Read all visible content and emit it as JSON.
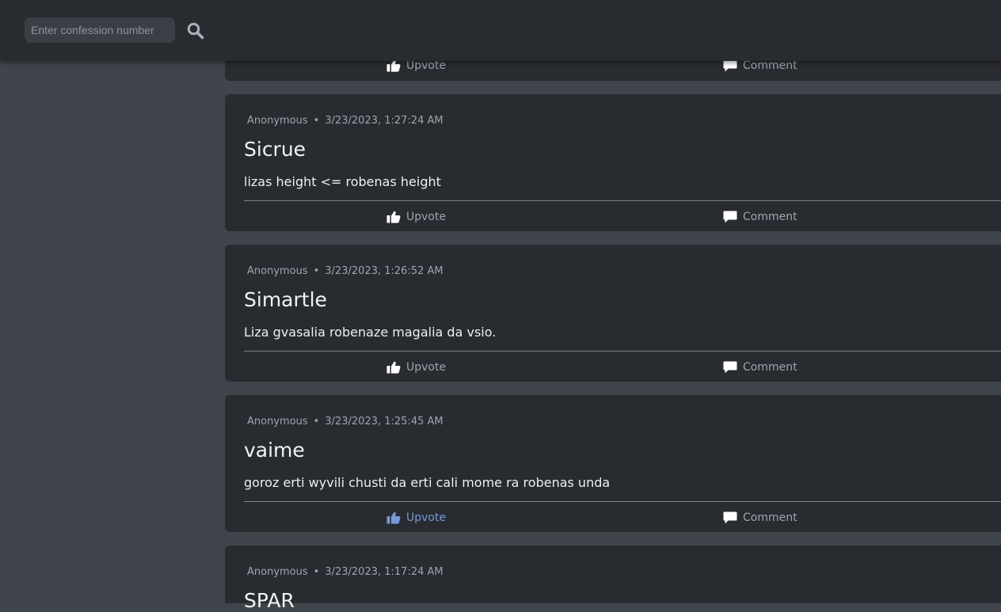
{
  "search": {
    "placeholder": "Enter confession number",
    "icon": "search-icon"
  },
  "labels": {
    "upvote": "Upvote",
    "comment": "Comment"
  },
  "colors": {
    "page_bg": "#40444b",
    "card_bg": "#282b30",
    "meta_text": "#9aa6b0",
    "upvote_active": "#7699d9"
  },
  "top_card": {
    "upvote_label": "Upvote",
    "comment_label": "Comment"
  },
  "posts": [
    {
      "author": "Anonymous",
      "timestamp": "3/23/2023, 1:27:24 AM",
      "title": "Sicrue",
      "body": "lizas height <= robenas height",
      "upvote_label": "Upvote",
      "comment_label": "Comment",
      "upvoted": false
    },
    {
      "author": "Anonymous",
      "timestamp": "3/23/2023, 1:26:52 AM",
      "title": "Simartle",
      "body": "Liza gvasalia robenaze magalia da vsio.",
      "upvote_label": "Upvote",
      "comment_label": "Comment",
      "upvoted": false
    },
    {
      "author": "Anonymous",
      "timestamp": "3/23/2023, 1:25:45 AM",
      "title": "vaime",
      "body": "goroz erti wyvili chusti da erti cali mome ra robenas unda",
      "upvote_label": "Upvote",
      "comment_label": "Comment",
      "upvoted": true
    },
    {
      "author": "Anonymous",
      "timestamp": "3/23/2023, 1:17:24 AM",
      "title": "SPAR"
    }
  ]
}
